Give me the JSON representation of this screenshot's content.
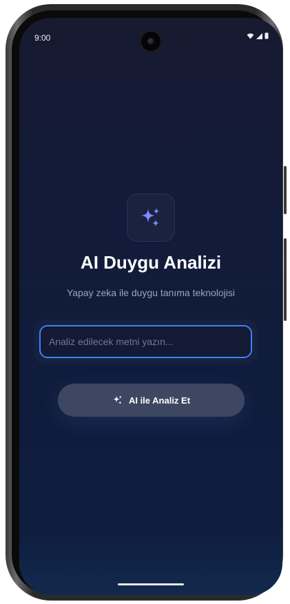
{
  "status_bar": {
    "time": "9:00",
    "icons": [
      "wifi-icon",
      "signal-icon",
      "battery-icon"
    ]
  },
  "app": {
    "logo_icon": "sparkles-icon",
    "title": "AI Duygu Analizi",
    "subtitle": "Yapay zeka ile duygu tanıma teknolojisi"
  },
  "input": {
    "placeholder": "Analiz edilecek metni yazın...",
    "value": ""
  },
  "analyze_button": {
    "icon": "sparkles-icon",
    "label": "AI ile Analiz Et"
  },
  "colors": {
    "accent": "#3b82f6",
    "sparkle": "#7c8cff",
    "background": "#131b39",
    "button": "#3d4761"
  }
}
